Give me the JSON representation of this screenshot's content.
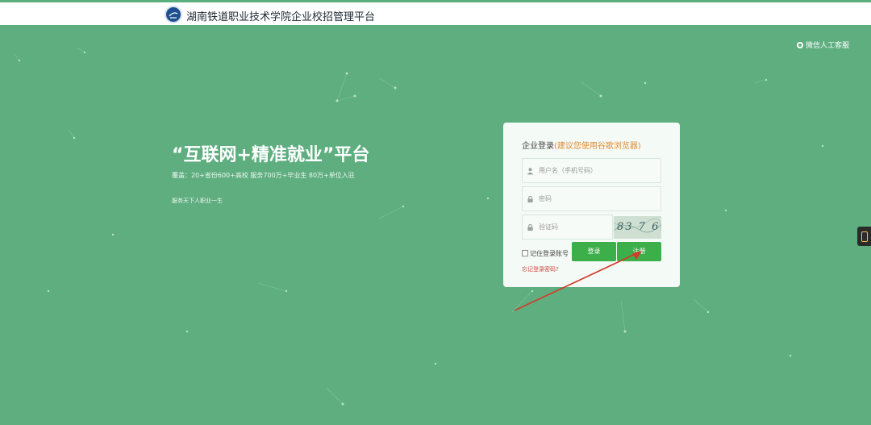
{
  "header": {
    "title": "湖南铁道职业技术学院企业校招管理平台",
    "logo_icon": "school-logo"
  },
  "hero": {
    "wechat_service": "微信人工客服",
    "slogan": "“互联网+精准就业”平台",
    "subtitle": "覆盖：20+省份600+高校    服务700万+毕业生    80万+单位入驻",
    "tagline": "服务天下人职业一生"
  },
  "login": {
    "title": "企业登录",
    "browser_hint": "(建议您使用谷歌浏览器)",
    "username_placeholder": "用户名（手机号码）",
    "password_placeholder": "密码",
    "captcha_placeholder": "验证码",
    "captcha_text": "83 7 6",
    "remember_label": "记住登录账号",
    "login_button": "登录",
    "register_button": "注册",
    "forgot_link": "忘记登录密码?"
  },
  "colors": {
    "background": "#5fae80",
    "button": "#3cae4a",
    "hint": "#e08a2e",
    "forgot": "#c8473c",
    "arrow": "#d23b2a"
  }
}
